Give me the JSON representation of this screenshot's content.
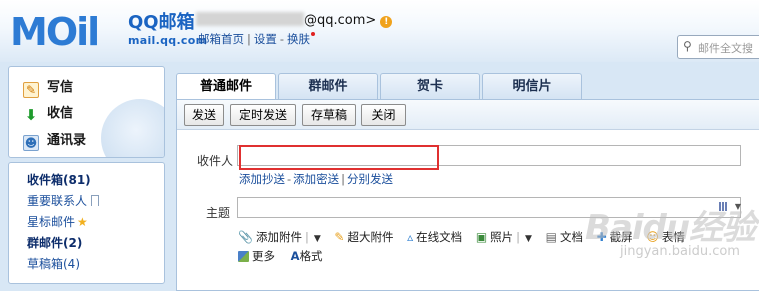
{
  "header": {
    "logo": "MOil",
    "product_cn": "QQ邮箱",
    "product_en": "mail.qq.com",
    "account_suffix": "@qq.com>",
    "warning_glyph": "!",
    "links": [
      "邮箱首页",
      "设置",
      "换肤"
    ],
    "search_placeholder": "邮件全文搜"
  },
  "sidebar": {
    "actions": [
      {
        "label": "写信",
        "icon": "pencil-icon"
      },
      {
        "label": "收信",
        "icon": "inbox-download-icon"
      },
      {
        "label": "通讯录",
        "icon": "contact-card-icon"
      }
    ],
    "folders": [
      {
        "label": "收件箱(81)",
        "bold": true
      },
      {
        "label": "重要联系人",
        "icon": "flag-icon"
      },
      {
        "label": "星标邮件",
        "icon": "star-icon"
      },
      {
        "label": "群邮件(2)",
        "bold": true
      },
      {
        "label": "草稿箱(4)"
      }
    ]
  },
  "compose": {
    "tabs": [
      "普通邮件",
      "群邮件",
      "贺卡",
      "明信片"
    ],
    "active_tab": "普通邮件",
    "toolbar": [
      "发送",
      "定时发送",
      "存草稿",
      "关闭"
    ],
    "recipient_label": "收件人",
    "recipient_value": "",
    "recipient_links": [
      "添加抄送",
      "添加密送",
      "分别发送"
    ],
    "subject_label": "主题",
    "subject_value": "",
    "attach_items": [
      {
        "label": "添加附件",
        "icon": "paperclip-icon",
        "dropdown": true
      },
      {
        "label": "超大附件",
        "icon": "large-attachment-icon"
      },
      {
        "label": "在线文档",
        "icon": "online-doc-icon"
      },
      {
        "label": "照片",
        "icon": "photo-icon",
        "dropdown": true
      },
      {
        "label": "文档",
        "icon": "document-icon"
      },
      {
        "label": "截屏",
        "icon": "screenshot-icon"
      },
      {
        "label": "表情",
        "icon": "emoji-icon"
      }
    ],
    "more_items": [
      {
        "label": "更多",
        "icon": "more-icon"
      },
      {
        "label": "格式",
        "icon": "format-icon"
      }
    ]
  },
  "watermark": {
    "text": "Baidu经验",
    "sub": "jingyan.baidu.com"
  },
  "colors": {
    "accent": "#2d7bd4",
    "highlight_box": "#e03030",
    "link": "#1b4f9c"
  }
}
